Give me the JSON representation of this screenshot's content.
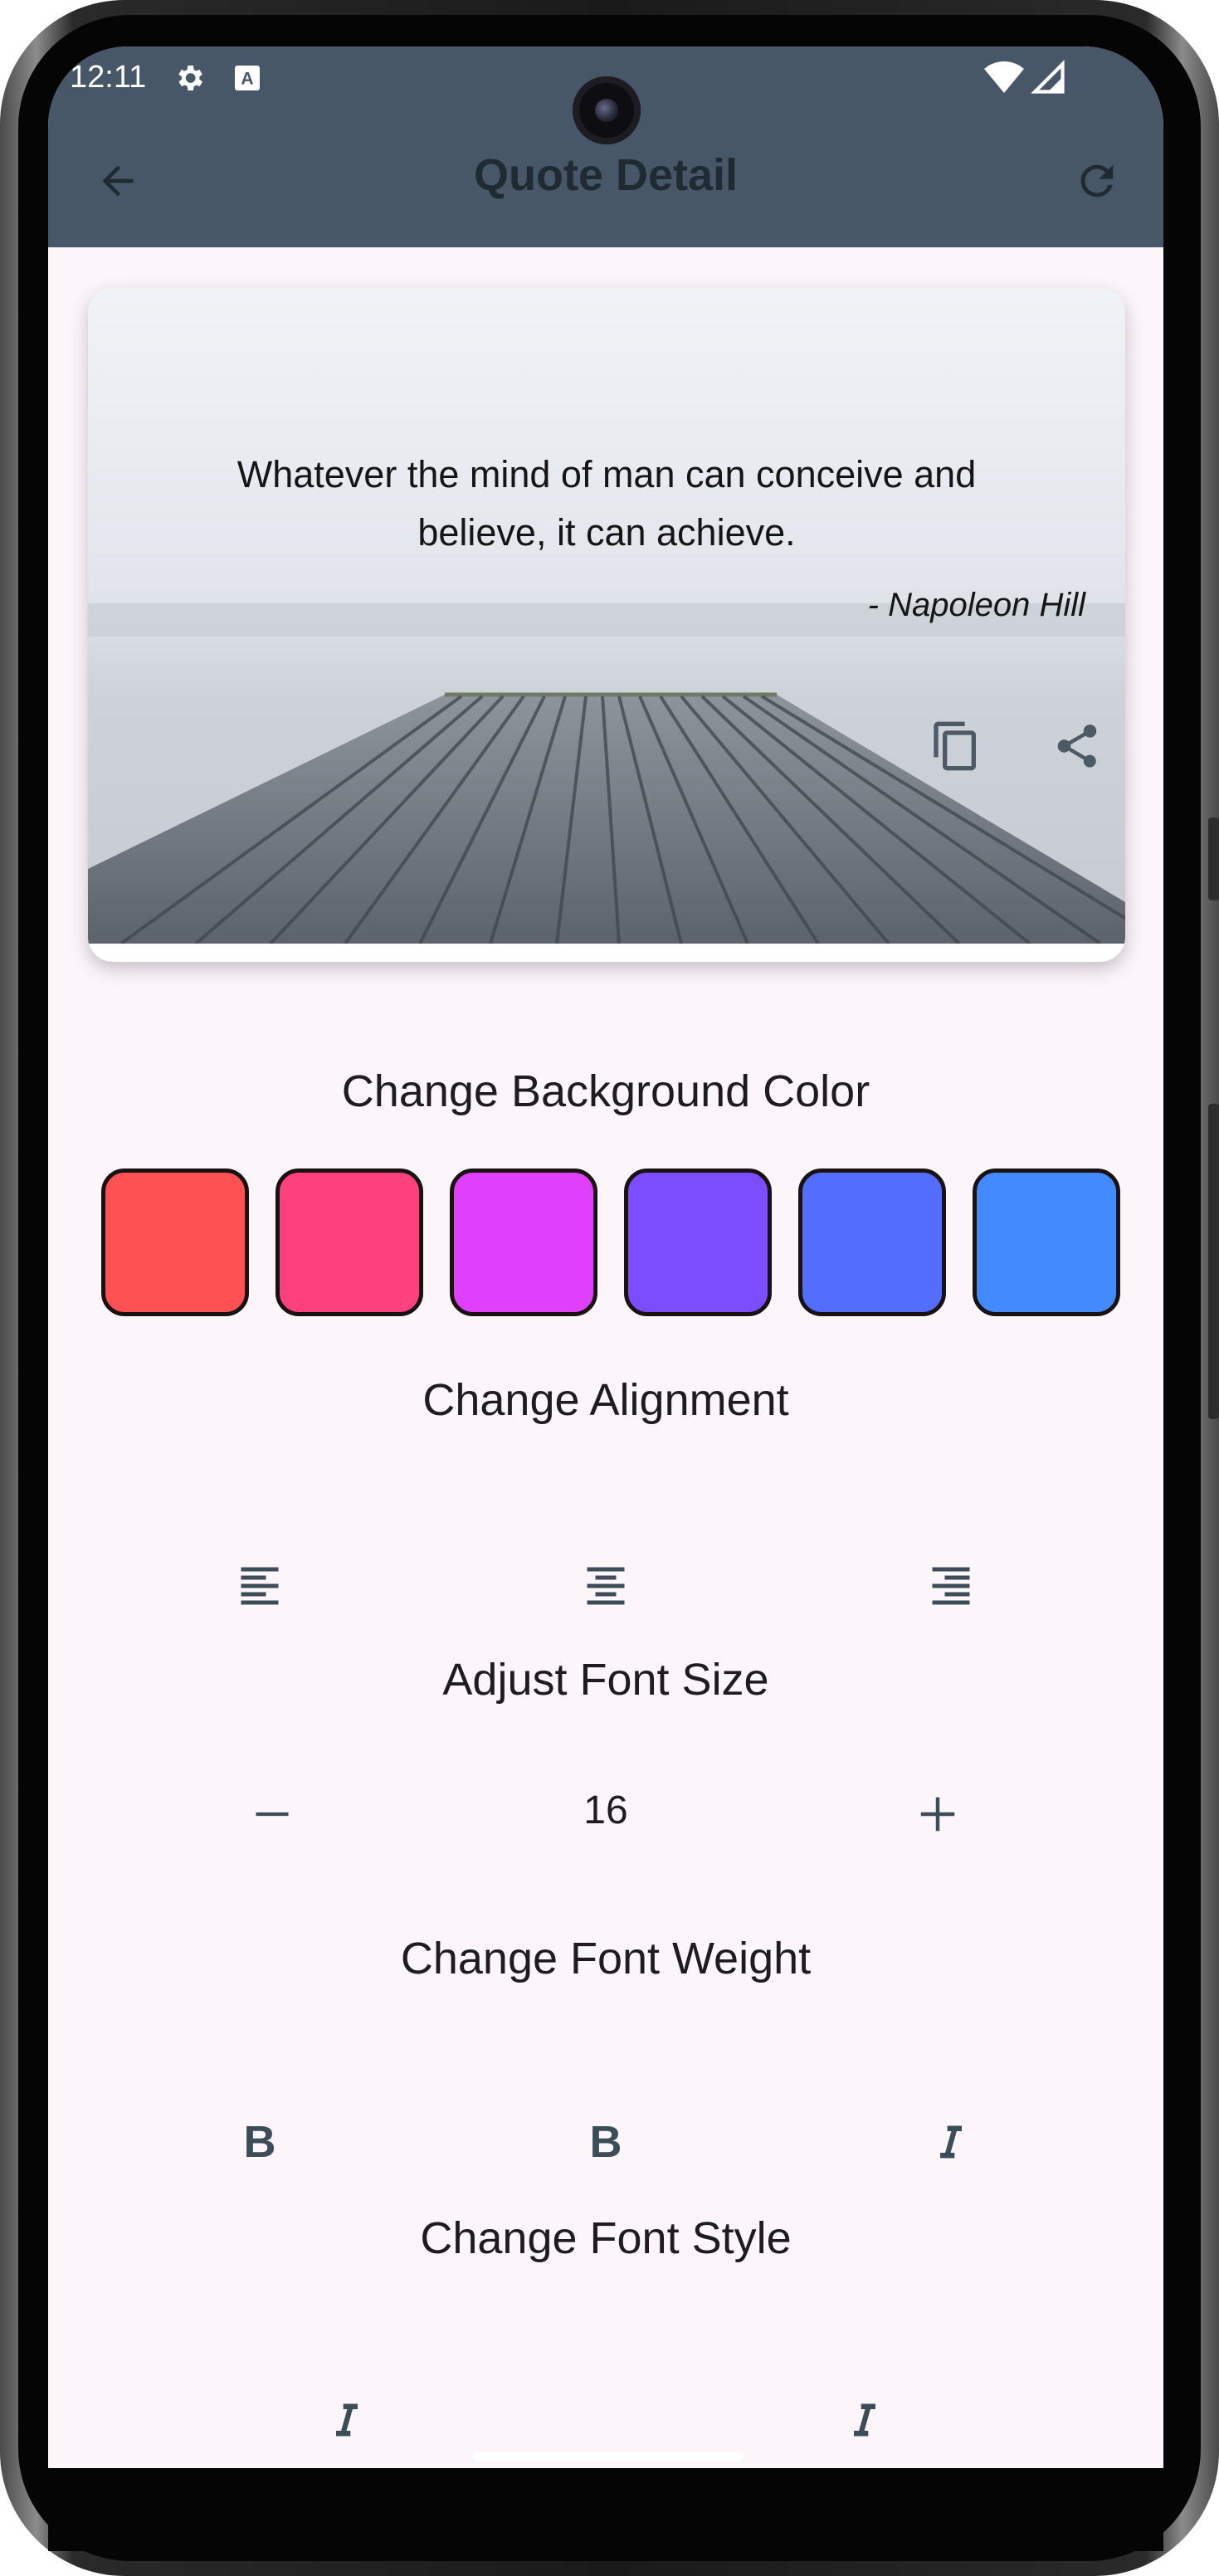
{
  "status_bar": {
    "time": "12:11",
    "icons": [
      "settings-icon",
      "a-text-icon",
      "wifi-icon",
      "signal-icon"
    ]
  },
  "app_bar": {
    "title": "Quote Detail",
    "back_icon": "arrow-back-icon",
    "refresh_icon": "refresh-icon",
    "color": "#475768"
  },
  "quote_card": {
    "text": "Whatever the mind of man can conceive and believe, it can achieve.",
    "author": "- Napoleon Hill",
    "copy_icon": "copy-icon",
    "share_icon": "share-icon"
  },
  "background_color": {
    "title": "Change Background Color",
    "colors": [
      "#fe5252",
      "#fe407f",
      "#e040fb",
      "#7c4dff",
      "#536dfe",
      "#448aff"
    ]
  },
  "alignment": {
    "title": "Change Alignment",
    "options": [
      "align-left-icon",
      "align-center-icon",
      "align-right-icon"
    ]
  },
  "font_size": {
    "title": "Adjust Font Size",
    "value": "16",
    "decrease_icon": "minus-icon",
    "increase_icon": "plus-icon"
  },
  "font_weight": {
    "title": "Change Font Weight",
    "options": [
      "B",
      "B"
    ],
    "italic_icon": "italic-icon"
  },
  "font_style": {
    "title": "Change Font Style",
    "options": [
      "italic-icon",
      "italic-icon"
    ]
  }
}
